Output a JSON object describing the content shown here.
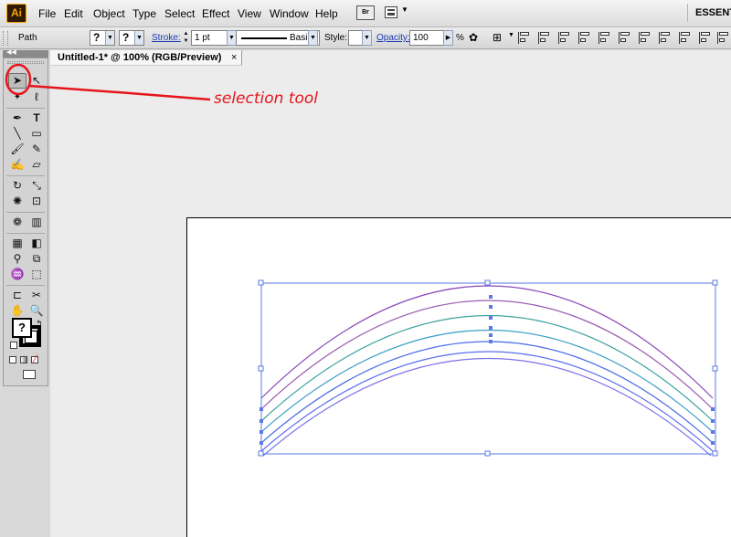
{
  "app": {
    "logo_text": "Ai",
    "menu": [
      "File",
      "Edit",
      "Object",
      "Type",
      "Select",
      "Effect",
      "View",
      "Window",
      "Help"
    ],
    "bridge_label": "Br",
    "workspace_label": "ESSENTI"
  },
  "control_bar": {
    "selection_type": "Path",
    "fill_symbol": "?",
    "stroke_symbol": "?",
    "stroke_label": "Stroke:",
    "stroke_weight": "1 pt",
    "brush_label": "Basic",
    "style_label": "Style:",
    "opacity_label": "Opacity:",
    "opacity_value": "100",
    "percent_sign": "%"
  },
  "document": {
    "tab_title": "Untitled-1* @ 100% (RGB/Preview)",
    "tab_close": "×"
  },
  "tools": {
    "fill_stroke_symbol": "?"
  },
  "annotation": {
    "label": "selection tool",
    "color": "#e8141c"
  },
  "colors": {
    "selection_blue": "#5a78e6",
    "arc_purple": "#8b4bb8",
    "arc_teal": "#3fa3a0"
  }
}
